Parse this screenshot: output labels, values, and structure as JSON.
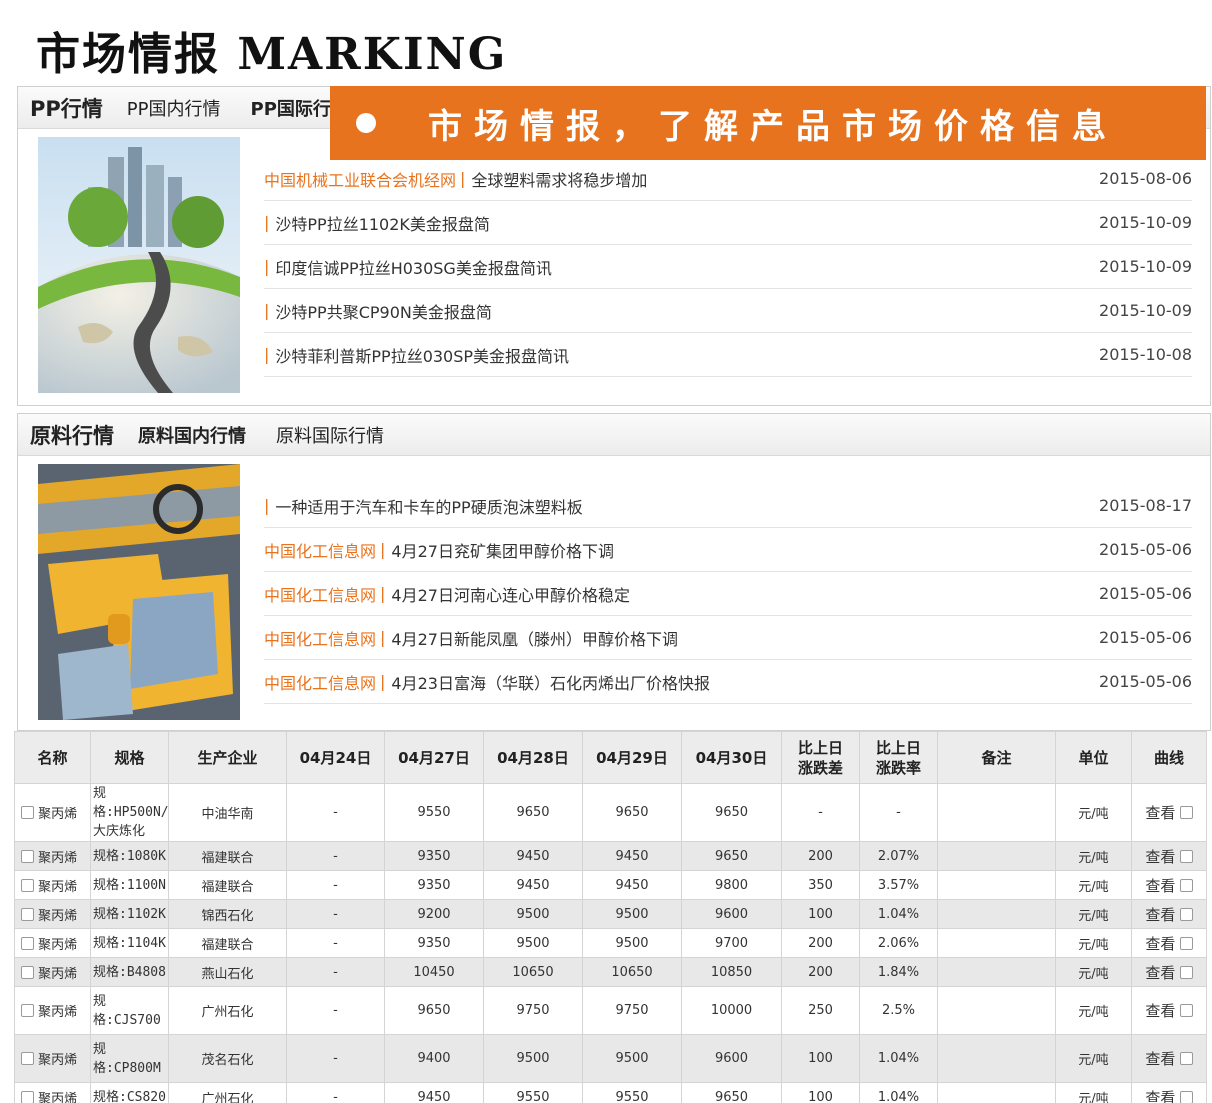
{
  "page_title": "市场情报 MARKING",
  "banner": {
    "text": "市场情报，了解产品市场价格信息"
  },
  "pp_panel": {
    "main_tab": "PP行情",
    "tabs": [
      "PP国内行情",
      "PP国际行"
    ],
    "news": [
      {
        "source": "中国机械工业联合会机经网",
        "title": "全球塑料需求将稳步增加",
        "date": "2015-08-06"
      },
      {
        "source": "",
        "title": "沙特PP拉丝1102K美金报盘简",
        "date": "2015-10-09"
      },
      {
        "source": "",
        "title": "印度信诚PP拉丝H030SG美金报盘简讯",
        "date": "2015-10-09"
      },
      {
        "source": "",
        "title": "沙特PP共聚CP90N美金报盘简",
        "date": "2015-10-09"
      },
      {
        "source": "",
        "title": "沙特菲利普斯PP拉丝030SP美金报盘简讯",
        "date": "2015-10-08"
      }
    ]
  },
  "raw_panel": {
    "main_tab": "原料行情",
    "tabs": [
      "原料国内行情",
      "原料国际行情"
    ],
    "news": [
      {
        "source": "",
        "title": "一种适用于汽车和卡车的PP硬质泡沫塑料板",
        "date": "2015-08-17"
      },
      {
        "source": "中国化工信息网",
        "title": "4月27日兖矿集团甲醇价格下调",
        "date": "2015-05-06"
      },
      {
        "source": "中国化工信息网",
        "title": "4月27日河南心连心甲醇价格稳定",
        "date": "2015-05-06"
      },
      {
        "source": "中国化工信息网",
        "title": "4月27日新能凤凰（滕州）甲醇价格下调",
        "date": "2015-05-06"
      },
      {
        "source": "中国化工信息网",
        "title": "4月23日富海（华联）石化丙烯出厂价格快报",
        "date": "2015-05-06"
      }
    ]
  },
  "price_table": {
    "headers": [
      "名称",
      "规格",
      "生产企业",
      "04月24日",
      "04月27日",
      "04月28日",
      "04月29日",
      "04月30日",
      "比上日涨跌差",
      "比上日涨跌率",
      "备注",
      "单位",
      "曲线"
    ],
    "header_lines": {
      "diff": [
        "比上日",
        "涨跌差"
      ],
      "rate": [
        "比上日",
        "涨跌率"
      ]
    },
    "rows": [
      {
        "name": "聚丙烯",
        "spec": "规格:HP500N/大庆炼化",
        "company": "中油华南",
        "d24": "-",
        "d27": "9550",
        "d28": "9650",
        "d29": "9650",
        "d30": "9650",
        "diff": "-",
        "rate": "-",
        "note": "",
        "unit": "元/吨",
        "curve": "查看"
      },
      {
        "name": "聚丙烯",
        "spec": "规格:1080K",
        "company": "福建联合",
        "d24": "-",
        "d27": "9350",
        "d28": "9450",
        "d29": "9450",
        "d30": "9650",
        "diff": "200",
        "rate": "2.07%",
        "note": "",
        "unit": "元/吨",
        "curve": "查看"
      },
      {
        "name": "聚丙烯",
        "spec": "规格:1100N",
        "company": "福建联合",
        "d24": "-",
        "d27": "9350",
        "d28": "9450",
        "d29": "9450",
        "d30": "9800",
        "diff": "350",
        "rate": "3.57%",
        "note": "",
        "unit": "元/吨",
        "curve": "查看"
      },
      {
        "name": "聚丙烯",
        "spec": "规格:1102K",
        "company": "锦西石化",
        "d24": "-",
        "d27": "9200",
        "d28": "9500",
        "d29": "9500",
        "d30": "9600",
        "diff": "100",
        "rate": "1.04%",
        "note": "",
        "unit": "元/吨",
        "curve": "查看"
      },
      {
        "name": "聚丙烯",
        "spec": "规格:1104K",
        "company": "福建联合",
        "d24": "-",
        "d27": "9350",
        "d28": "9500",
        "d29": "9500",
        "d30": "9700",
        "diff": "200",
        "rate": "2.06%",
        "note": "",
        "unit": "元/吨",
        "curve": "查看"
      },
      {
        "name": "聚丙烯",
        "spec": "规格:B4808",
        "company": "燕山石化",
        "d24": "-",
        "d27": "10450",
        "d28": "10650",
        "d29": "10650",
        "d30": "10850",
        "diff": "200",
        "rate": "1.84%",
        "note": "",
        "unit": "元/吨",
        "curve": "查看"
      },
      {
        "name": "聚丙烯",
        "spec": "规格:CJS700",
        "company": "广州石化",
        "d24": "-",
        "d27": "9650",
        "d28": "9750",
        "d29": "9750",
        "d30": "10000",
        "diff": "250",
        "rate": "2.5%",
        "note": "",
        "unit": "元/吨",
        "curve": "查看"
      },
      {
        "name": "聚丙烯",
        "spec": "规格:CP800M",
        "company": "茂名石化",
        "d24": "-",
        "d27": "9400",
        "d28": "9500",
        "d29": "9500",
        "d30": "9600",
        "diff": "100",
        "rate": "1.04%",
        "note": "",
        "unit": "元/吨",
        "curve": "查看"
      },
      {
        "name": "聚丙烯",
        "spec": "规格:CS820",
        "company": "广州石化",
        "d24": "-",
        "d27": "9450",
        "d28": "9550",
        "d29": "9550",
        "d30": "9650",
        "diff": "100",
        "rate": "1.04%",
        "note": "",
        "unit": "元/吨",
        "curve": "查看"
      }
    ]
  },
  "colors": {
    "accent": "#e8731e",
    "row_shade": "#e8e8e8",
    "header_bg": "#ececec"
  }
}
